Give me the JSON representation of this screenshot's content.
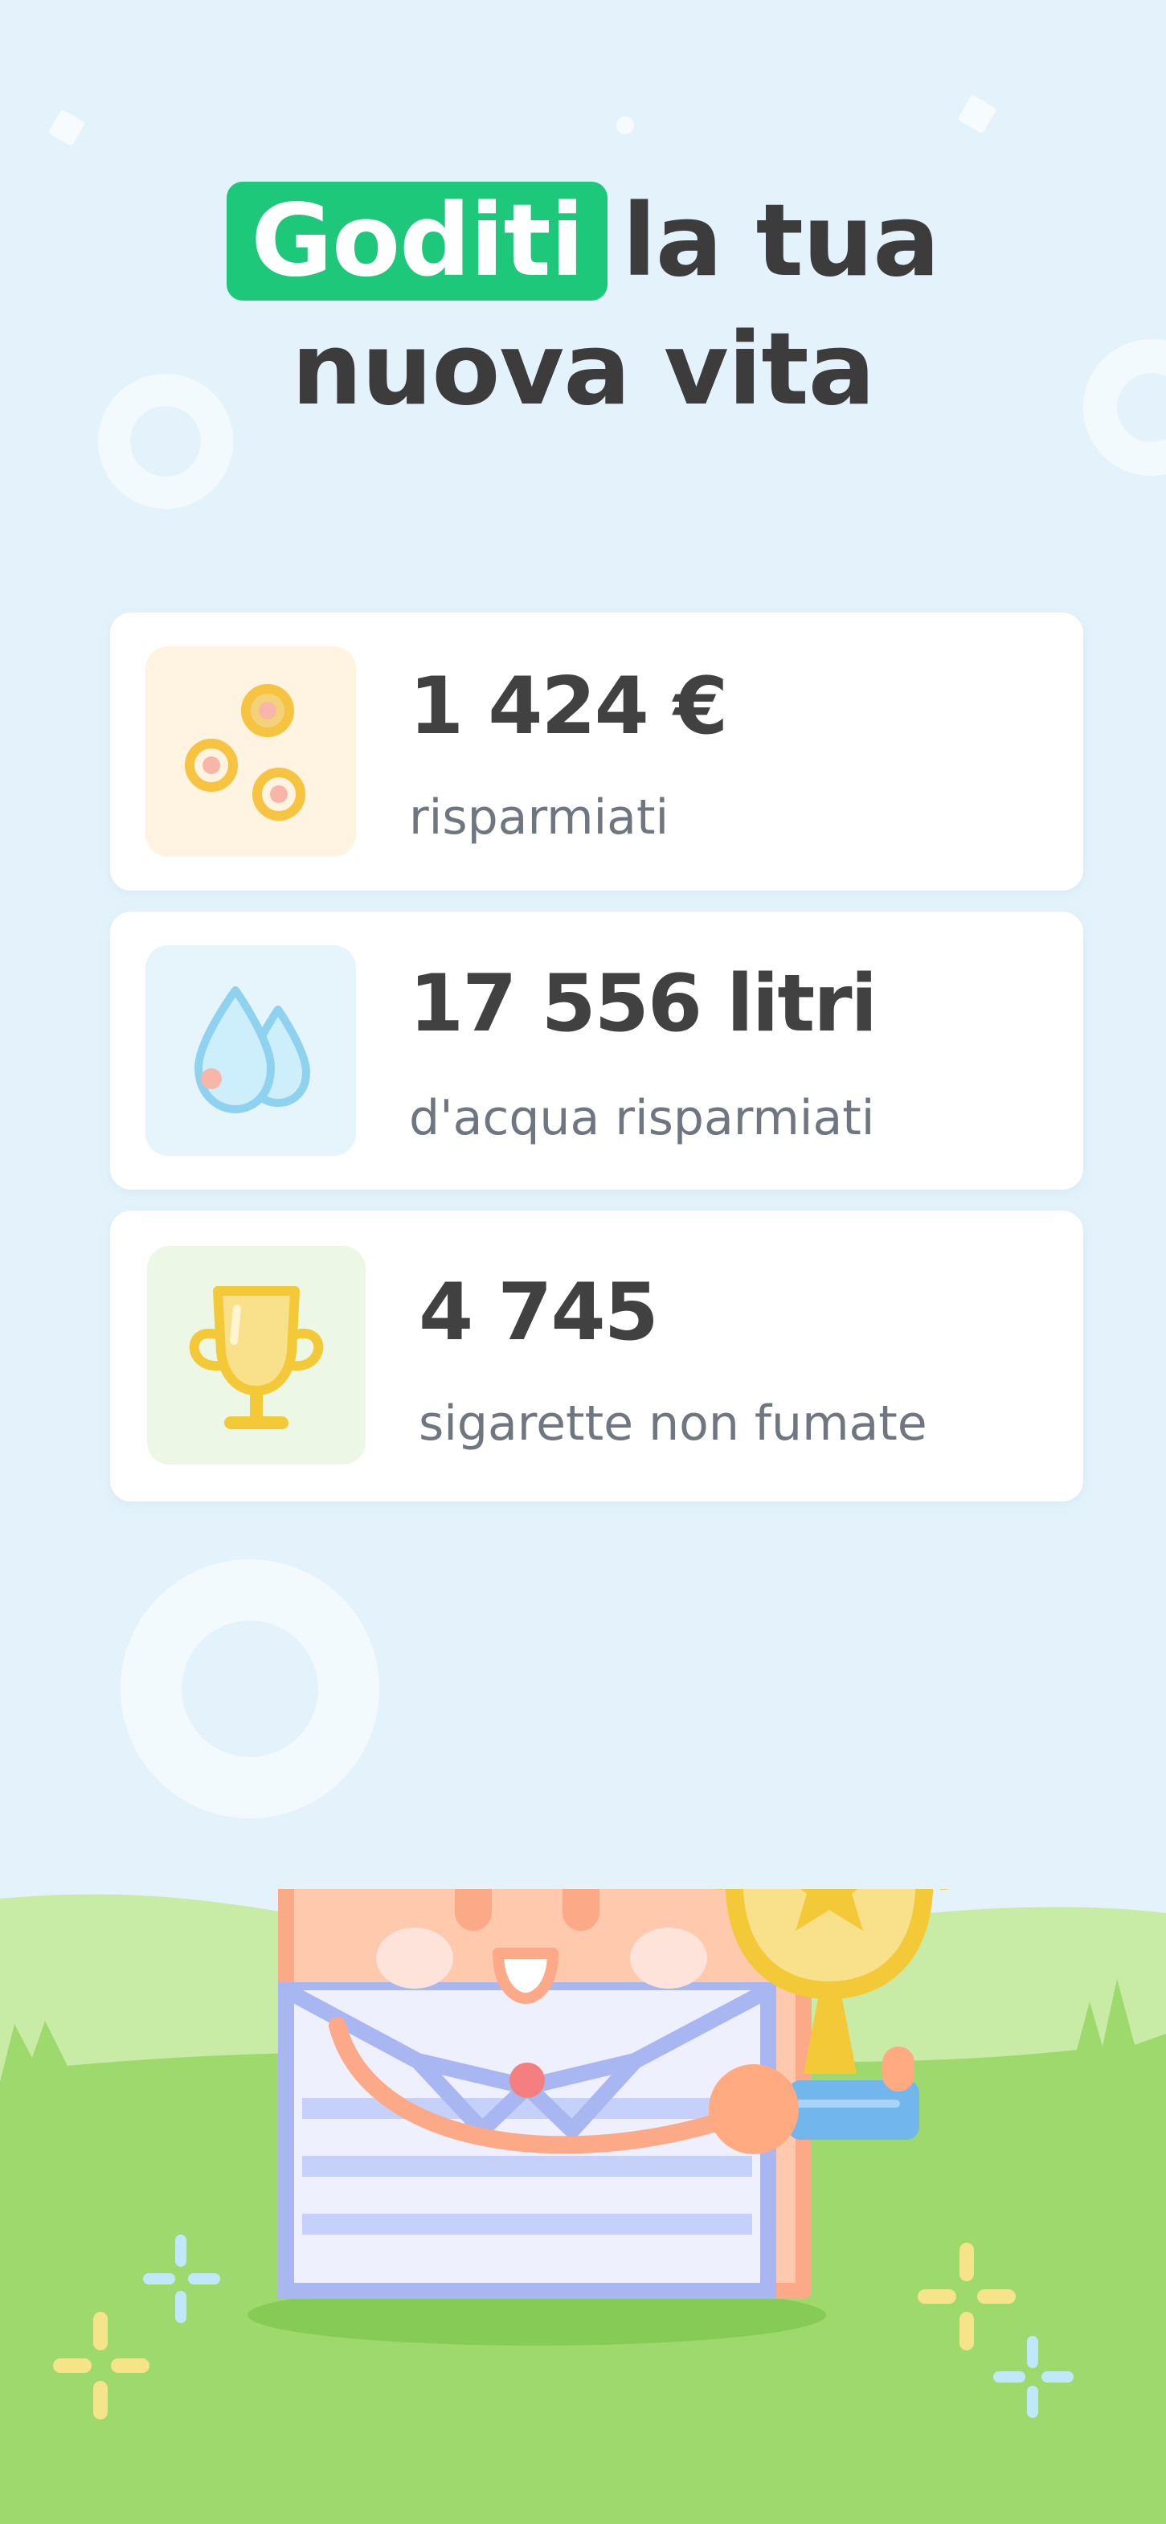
{
  "headline": {
    "highlight": "Goditi",
    "line1_rest": "la tua",
    "line2": "nuova vita"
  },
  "stats": [
    {
      "value": "1 424 €",
      "label": "risparmiati",
      "icon": "coins-icon",
      "tile_color": "#fff4e1"
    },
    {
      "value": "17 556 litri",
      "label": "d'acqua risparmiati",
      "icon": "water-drops-icon",
      "tile_color": "#e6f4fc"
    },
    {
      "value": "4 745",
      "label": "sigarette non fumate",
      "icon": "trophy-icon",
      "tile_color": "#edf7e6"
    }
  ],
  "illustration": {
    "icon": "toast-mascot-with-trophy-illustration"
  },
  "colors": {
    "background": "#e4f3fb",
    "accent": "#1ec87b",
    "text_dark": "#414141",
    "text_muted": "#6f7680",
    "grass": "#9dd96d"
  }
}
